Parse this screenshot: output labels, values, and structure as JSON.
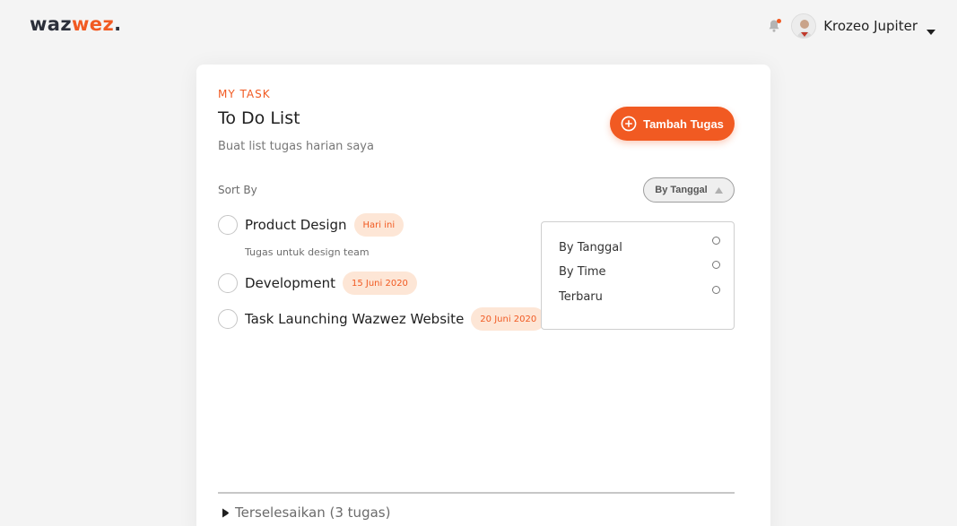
{
  "brand": {
    "logo_part1": "waz",
    "logo_part2": "wez",
    "logo_dot": ".",
    "accent_color": "#f15a22"
  },
  "header": {
    "user_name": "Krozeo Jupiter"
  },
  "card": {
    "eyebrow": "MY TASK",
    "title": "To Do List",
    "subtitle": "Buat list tugas harian saya",
    "add_button_label": "Tambah Tugas"
  },
  "sort": {
    "label": "Sort By",
    "selected": "By Tanggal",
    "options": [
      {
        "label": "By Tanggal"
      },
      {
        "label": "By Time"
      },
      {
        "label": "Terbaru"
      }
    ]
  },
  "tasks": [
    {
      "name": "Product Design",
      "tag": "Hari ini",
      "description": "Tugas untuk design team"
    },
    {
      "name": "Development",
      "tag": "15 Juni 2020"
    },
    {
      "name": "Task Launching Wazwez Website",
      "tag": "20 Juni 2020"
    }
  ],
  "completed": {
    "label": "Terselesaikan (3 tugas)"
  },
  "icons": [
    "bell-icon",
    "avatar",
    "caret-down-icon",
    "plus-circle-icon",
    "triangle-up-icon",
    "triangle-right-icon"
  ]
}
